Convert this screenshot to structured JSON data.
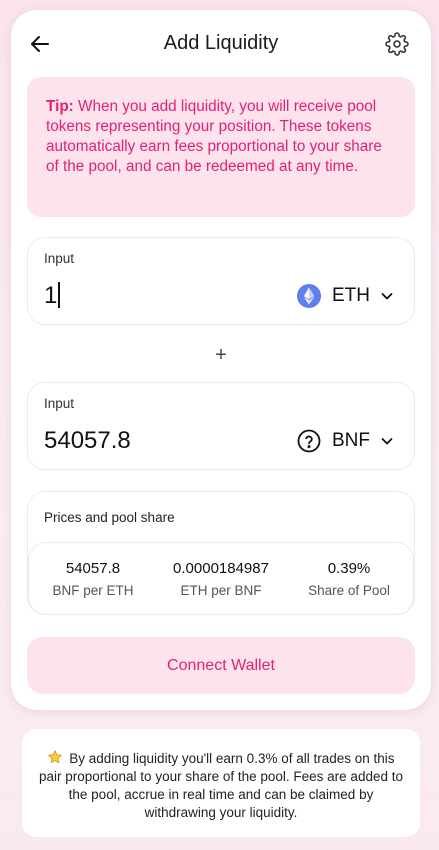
{
  "header": {
    "title": "Add Liquidity",
    "back_icon": "arrow-left-icon",
    "settings_icon": "gear-icon"
  },
  "tip": {
    "label": "Tip:",
    "text": "When you add liquidity, you will receive pool tokens representing your position. These tokens automatically earn fees proportional to your share of the pool, and can be redeemed at any time."
  },
  "input_a": {
    "label": "Input",
    "value": "1",
    "token": "ETH",
    "token_icon": "ethereum-icon"
  },
  "plus_symbol": "+",
  "input_b": {
    "label": "Input",
    "value": "54057.8",
    "token": "BNF",
    "token_icon": "question-icon"
  },
  "prices": {
    "title": "Prices and pool share",
    "items": [
      {
        "value": "54057.8",
        "label": "BNF per ETH"
      },
      {
        "value": "0.0000184987",
        "label": "ETH per BNF"
      },
      {
        "value": "0.39%",
        "label": "Share of Pool"
      }
    ]
  },
  "connect_button": "Connect Wallet",
  "footer": {
    "icon": "star-icon",
    "text": "By adding liquidity you'll earn 0.3% of all trades on this pair proportional to your share of the pool. Fees are added to the pool, accrue in real time and can be claimed by withdrawing your liquidity."
  },
  "colors": {
    "accent": "#e51f78",
    "tip_bg": "#fde3ec",
    "page_bg": "#fbe4ee",
    "eth_blue": "#627eea"
  }
}
